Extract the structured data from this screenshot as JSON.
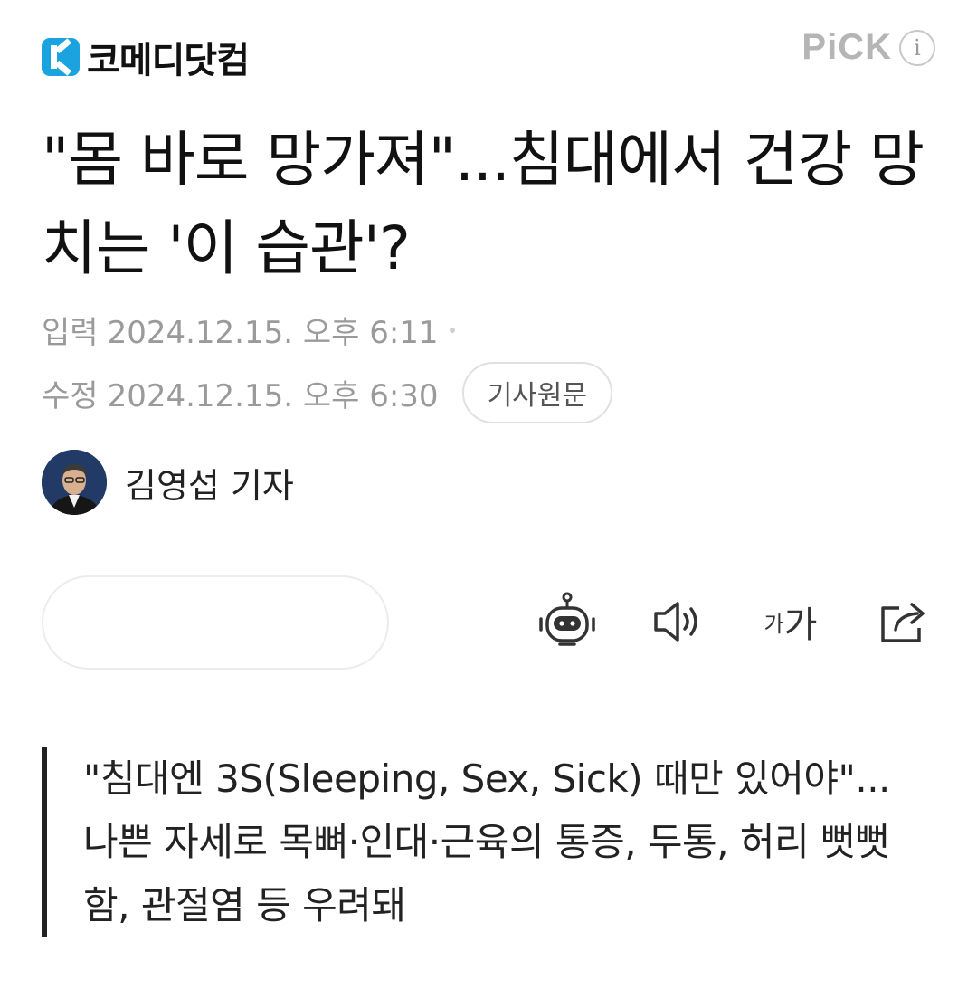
{
  "header": {
    "logo_text": "코메디닷컴",
    "pick_label": "PiCK",
    "info_glyph": "i"
  },
  "article": {
    "title": "\"몸 바로 망가져\"...침대에서 건강 망치는 '이 습관'?",
    "published_label": "입력",
    "published_value": "2024.12.15. 오후 6:11",
    "modified_label": "수정",
    "modified_value": "2024.12.15. 오후 6:30",
    "original_button": "기사원문",
    "author": "김영섭 기자",
    "subtitle": "\"침대엔 3S(Sleeping, Sex, Sick) 때만 있어야\"...나쁜 자세로 목뼈·인대·근육의 통증, 두통, 허리 뻣뻣함, 관절염 등 우려돼"
  },
  "toolbar": {
    "icons": [
      "robot-summary-icon",
      "speaker-icon",
      "font-size-icon",
      "share-icon"
    ],
    "font_small": "가",
    "font_large": "가"
  },
  "colors": {
    "logo_blue": "#1aa3de",
    "meta_gray": "#9a9a9a",
    "quote_bar": "#222222"
  }
}
